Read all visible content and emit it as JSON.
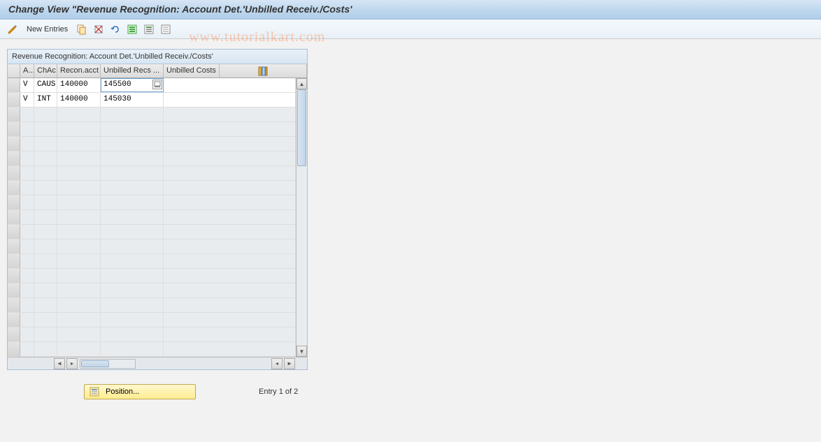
{
  "title": "Change View \"Revenue Recognition: Account Det.'Unbilled Receiv./Costs'",
  "toolbar": {
    "new_entries_label": "New Entries"
  },
  "grid": {
    "title": "Revenue Recognition: Account Det.'Unbilled Receiv./Costs'",
    "columns": {
      "a": "A...",
      "chac": "ChAc",
      "recon": "Recon.acct",
      "unbilled_recs": "Unbilled Recs ...",
      "unbilled_costs": "Unbilled Costs ..."
    },
    "rows": [
      {
        "a": "V",
        "chac": "CAUS",
        "recon": "140000",
        "unbilled_recs": "145500",
        "unbilled_costs": "",
        "selected": true
      },
      {
        "a": "V",
        "chac": "INT",
        "recon": "140000",
        "unbilled_recs": "145030",
        "unbilled_costs": "",
        "selected": false
      }
    ],
    "empty_rows": 17
  },
  "bottom": {
    "position_label": "Position...",
    "entry_text": "Entry 1 of 2"
  },
  "watermark": "www.tutorialkart.com"
}
